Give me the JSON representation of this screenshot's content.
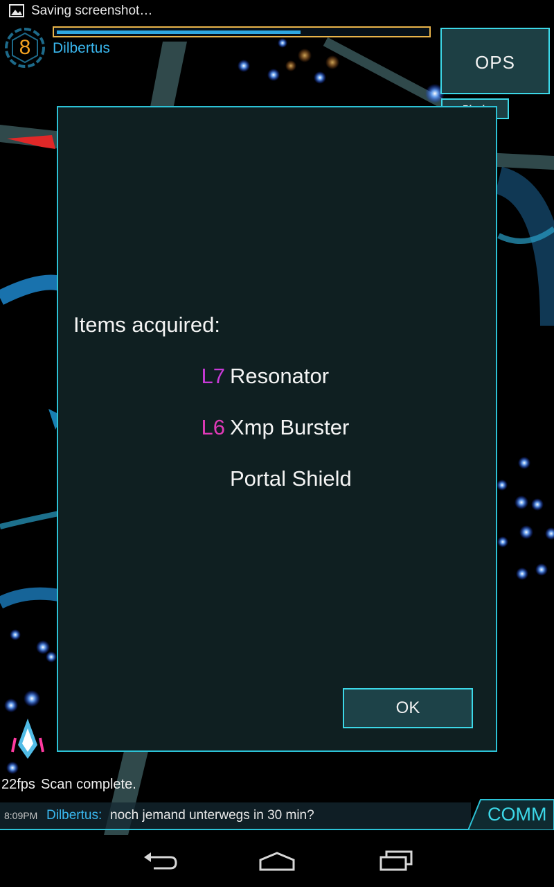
{
  "status_bar": {
    "notification": "Saving screenshot…",
    "icon": "image-icon"
  },
  "hud": {
    "level": "8",
    "agent_name": "Dilbertus",
    "xp_progress": 0.66,
    "ops_label": "OPS",
    "block_label": "Block"
  },
  "dialog": {
    "heading": "Items acquired:",
    "items": [
      {
        "level": "L7",
        "level_color": "#c83ad8",
        "name": "Resonator"
      },
      {
        "level": "L6",
        "level_color": "#e03ab8",
        "name": "Xmp Burster"
      },
      {
        "level": "",
        "level_color": "#ffffff",
        "name": "Portal Shield"
      }
    ],
    "ok_label": "OK"
  },
  "status_line": {
    "fps": "22fps",
    "message": "Scan complete."
  },
  "comm": {
    "time": "8:09PM",
    "sender": "Dilbertus:",
    "message": "noch jemand unterwegs in 30 min?",
    "button_label": "COMM"
  },
  "nav": {
    "back_icon": "back-icon",
    "home_icon": "home-icon",
    "recents_icon": "recents-icon"
  },
  "colors": {
    "accent": "#2cc2d6",
    "agent_blue": "#3ab8f0",
    "level_orange": "#f0a020"
  }
}
